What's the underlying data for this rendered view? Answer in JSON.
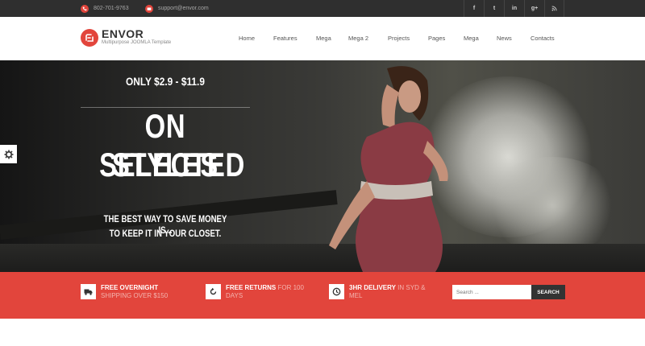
{
  "topbar": {
    "phone": "802-701-9763",
    "email": "support@envor.com",
    "phone_icon": "phone-icon",
    "email_icon": "mail-icon",
    "social": [
      {
        "label": "f",
        "icon": "facebook-icon"
      },
      {
        "label": "t",
        "icon": "twitter-icon"
      },
      {
        "label": "in",
        "icon": "linkedin-icon"
      },
      {
        "label": "g+",
        "icon": "google-plus-icon"
      },
      {
        "label": "rss",
        "icon": "rss-icon"
      }
    ]
  },
  "header": {
    "brand": "ENVOR",
    "tagline": "Multipurpose JOOMLA Template",
    "nav": [
      "Home",
      "Features",
      "Mega",
      "Mega 2",
      "Projects",
      "Pages",
      "Mega",
      "News",
      "Contacts"
    ]
  },
  "hero": {
    "price": "ONLY $2.9 - $11.9",
    "headline_line1": "ON SELECTED",
    "headline_line2": "STYLES",
    "sub_line1": "THE BEST WAY TO SAVE MONEY IS...",
    "sub_line2": "TO KEEP IT IN YOUR CLOSET."
  },
  "features": [
    {
      "title": "FREE OVERNIGHT",
      "rest": "SHIPPING OVER $150",
      "icon": "truck-icon"
    },
    {
      "title": "FREE RETURNS",
      "rest": "FOR 100 DAYS",
      "icon": "return-arrow-icon"
    },
    {
      "title": "3HR DELIVERY",
      "rest": "IN SYD & MEL",
      "icon": "clock-icon"
    }
  ],
  "search": {
    "placeholder": "Search ...",
    "button": "SEARCH"
  },
  "colors": {
    "accent": "#e2453c",
    "topbar": "#2f2f2f"
  }
}
